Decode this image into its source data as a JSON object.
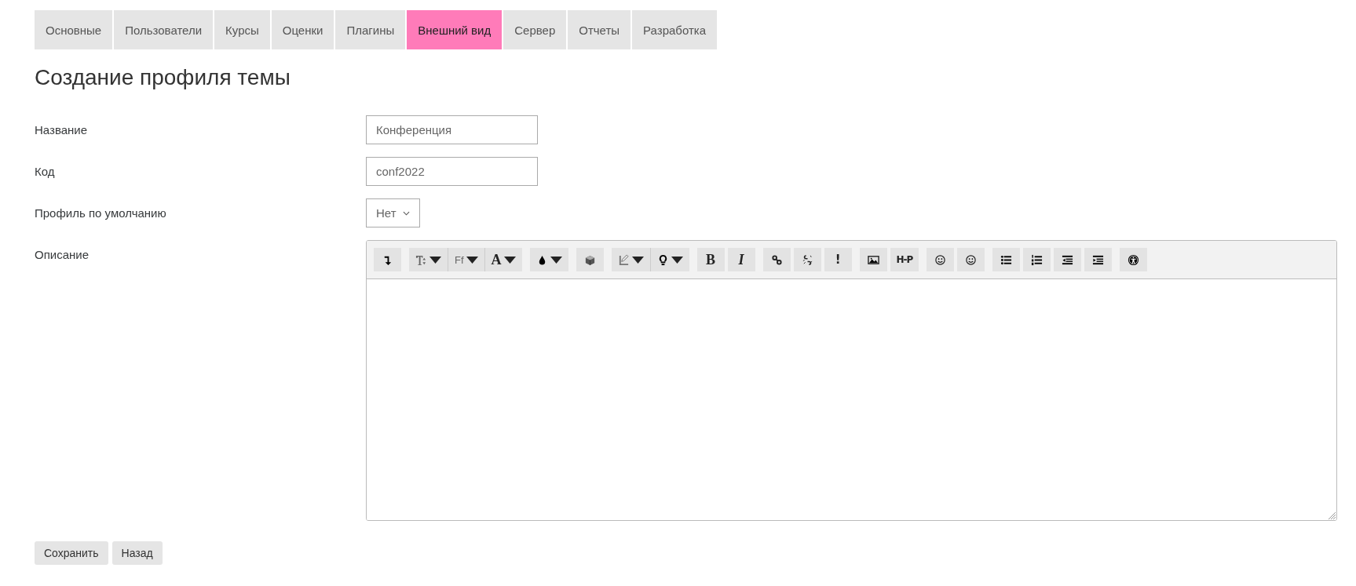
{
  "tabs": [
    {
      "label": "Основные",
      "selected": false
    },
    {
      "label": "Пользователи",
      "selected": false
    },
    {
      "label": "Курсы",
      "selected": false
    },
    {
      "label": "Оценки",
      "selected": false
    },
    {
      "label": "Плагины",
      "selected": false
    },
    {
      "label": "Внешний вид",
      "selected": true
    },
    {
      "label": "Сервер",
      "selected": false
    },
    {
      "label": "Отчеты",
      "selected": false
    },
    {
      "label": "Разработка",
      "selected": false
    }
  ],
  "title": "Создание профиля темы",
  "fields": [
    {
      "kind": "text",
      "label": "Название",
      "value": "Конференция"
    },
    {
      "kind": "text",
      "label": "Код",
      "value": "conf2022"
    },
    {
      "kind": "select",
      "label": "Профиль по умолчанию",
      "value": "Нет"
    },
    {
      "kind": "editor",
      "label": "Описание"
    }
  ],
  "editor_toolbar": [
    [
      {
        "kind": "icon",
        "dropdown": false
      }
    ],
    [
      {
        "kind": "icon",
        "dropdown": true
      },
      {
        "kind": "glyph",
        "label": "Ff",
        "dropdown": true
      },
      {
        "kind": "glyph",
        "label": "A",
        "dropdown": true
      }
    ],
    [
      {
        "kind": "icon",
        "dropdown": true
      }
    ],
    [
      {
        "kind": "icon",
        "dropdown": false
      }
    ],
    [
      {
        "kind": "icon",
        "dropdown": true
      },
      {
        "kind": "icon",
        "dropdown": true
      }
    ],
    [
      {
        "kind": "glyph",
        "label": "B",
        "dropdown": false
      },
      {
        "kind": "glyph",
        "label": "I",
        "dropdown": false
      }
    ],
    [
      {
        "kind": "icon",
        "dropdown": false
      },
      {
        "kind": "icon",
        "dropdown": false
      },
      {
        "kind": "glyph",
        "label": "!",
        "dropdown": false
      }
    ],
    [
      {
        "kind": "icon",
        "dropdown": false
      },
      {
        "kind": "glyph",
        "label": "H-P",
        "dropdown": false
      }
    ],
    [
      {
        "kind": "icon",
        "dropdown": false
      },
      {
        "kind": "icon",
        "dropdown": false
      }
    ],
    [
      {
        "kind": "icon",
        "dropdown": false
      },
      {
        "kind": "icon",
        "dropdown": false
      },
      {
        "kind": "icon",
        "dropdown": false
      },
      {
        "kind": "icon",
        "dropdown": false
      }
    ],
    [
      {
        "kind": "icon",
        "dropdown": false
      }
    ]
  ],
  "buttons": [
    "Сохранить",
    "Назад"
  ]
}
